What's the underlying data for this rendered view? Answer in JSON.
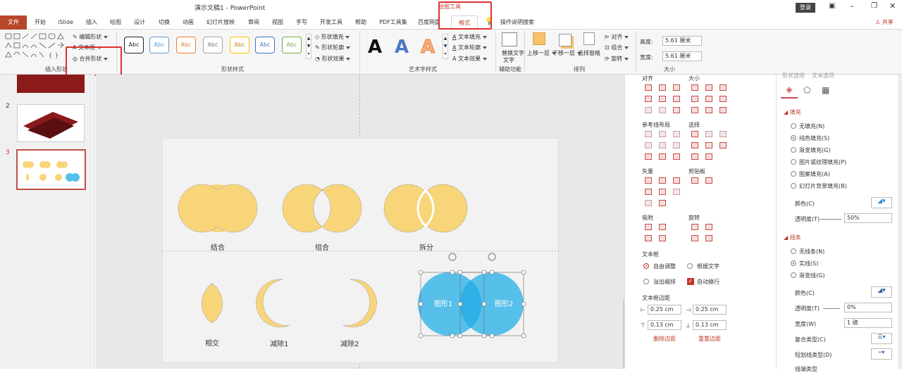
{
  "window": {
    "title": "演示文稿1 - PowerPoint",
    "login": "登录",
    "share": "共享"
  },
  "context_tab": "绘图工具",
  "tabs": [
    "文件",
    "开始",
    "iSlide",
    "插入",
    "绘图",
    "设计",
    "切换",
    "动画",
    "幻灯片放映",
    "审阅",
    "视图",
    "手写",
    "开发工具",
    "帮助",
    "PDF工具集",
    "百度网盘",
    "格式"
  ],
  "search_hint": "操作说明搜索",
  "ribbon": {
    "insert_shapes": {
      "edit_shape": "编辑形状",
      "textbox": "文本框",
      "merge_shapes": "合并形状",
      "label": "插入形状"
    },
    "shape_styles": {
      "abc": "Abc",
      "fill": "形状填充",
      "outline": "形状轮廓",
      "effects": "形状效果",
      "label": "形状样式"
    },
    "wordart": {
      "a": "A",
      "fill": "文本填充",
      "outline": "文本轮廓",
      "effects": "文本效果",
      "label": "艺术字样式"
    },
    "accessibility": {
      "alt_text": "替换文字",
      "alt_text2": "文字",
      "label": "辅助功能"
    },
    "arrange": {
      "bring_forward": "上移一层",
      "send_backward": "下移一层",
      "selection_pane": "选择窗格",
      "align": "对齐",
      "group": "组合",
      "rotate": "旋转",
      "label": "排列"
    },
    "size": {
      "height_label": "高度:",
      "height": "5.61 厘米",
      "width_label": "宽度:",
      "width": "5.61 厘米",
      "label": "大小"
    }
  },
  "slides": [
    "2",
    "3"
  ],
  "canvas": {
    "labels": [
      "结合",
      "组合",
      "拆分",
      "相交",
      "减除1",
      "减除2"
    ],
    "shape1": "图形1",
    "shape2": "图形2"
  },
  "islide_panel": {
    "align": "对齐",
    "size": "大小",
    "guide_layout": "参考线布局",
    "select": "选择",
    "vector": "矢量",
    "clipboard": "剪贴板",
    "snap": "吸附",
    "rotate": "旋转",
    "textbox": "文本框",
    "autofit": "自由调整",
    "fit_text": "根据文字",
    "overflow": "溢出缩排",
    "autowrap": "自动换行",
    "margin": "文本框边距",
    "m1": "0.25 cm",
    "m2": "0.25 cm",
    "m3": "0.13 cm",
    "m4": "0.13 cm",
    "delete_margin": "删除边距",
    "reset_margin": "重置边距"
  },
  "format_panel": {
    "tab1": "形状选项",
    "tab2": "文本选项",
    "fill_header": "填充",
    "fill_options": [
      "无填充(N)",
      "纯色填充(S)",
      "渐变填充(G)",
      "图片或纹理填充(P)",
      "图案填充(A)",
      "幻灯片背景填充(B)"
    ],
    "color": "颜色(C)",
    "transparency": "透明度(T)",
    "transparency_val": "50%",
    "line_header": "线条",
    "line_options": [
      "无线条(N)",
      "实线(S)",
      "渐变线(G)"
    ],
    "line_color": "颜色(C)",
    "line_transparency": "透明度(T)",
    "line_transparency_val": "0%",
    "width": "宽度(W)",
    "width_val": "1 磅",
    "compound": "复合类型(C)",
    "dash": "短划线类型(D)",
    "cap": "线端类型"
  },
  "colors": {
    "accent": "#b7472a",
    "shape_fill": "#f9d57a",
    "blue": "#57c0ea",
    "red_box": "#e03030"
  }
}
